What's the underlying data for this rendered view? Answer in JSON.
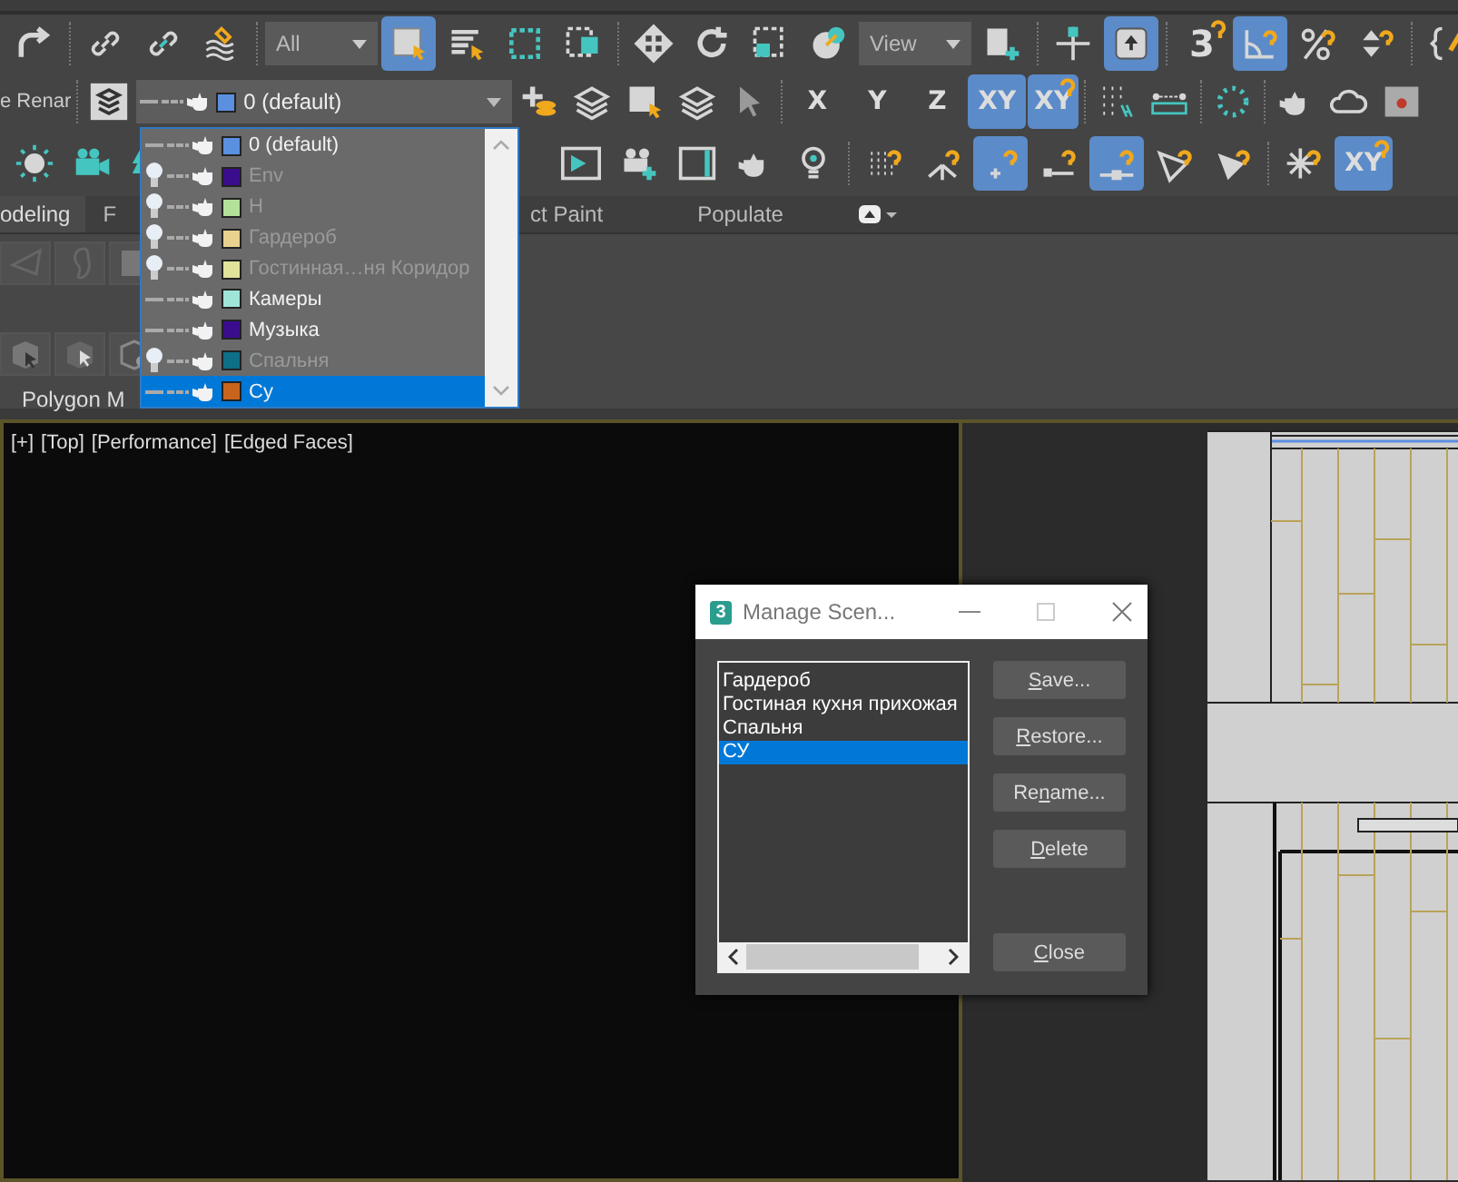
{
  "main_toolbar": {
    "rows": [
      {
        "groups": [
          {
            "items": [
              {
                "kind": "redo",
                "selected": false
              }
            ]
          },
          {
            "items": [
              {
                "kind": "link",
                "selected": false
              },
              {
                "kind": "unlink",
                "selected": false
              },
              {
                "kind": "bind",
                "selected": false
              }
            ]
          },
          {
            "items": [
              {
                "kind": "dropdown",
                "value": "All"
              },
              {
                "kind": "select",
                "selected": true
              },
              {
                "kind": "select_list",
                "selected": false
              },
              {
                "kind": "region",
                "selected": false
              },
              {
                "kind": "crossing",
                "selected": false
              }
            ]
          },
          {
            "items": [
              {
                "kind": "move",
                "selected": false
              },
              {
                "kind": "rotate",
                "selected": false
              },
              {
                "kind": "region_alt",
                "selected": false
              },
              {
                "kind": "place",
                "selected": false
              },
              {
                "kind": "dropdown",
                "value": "View"
              },
              {
                "kind": "pivot",
                "selected": false
              }
            ]
          },
          {
            "items": [
              {
                "kind": "manipulate",
                "selected": false
              },
              {
                "kind": "shortcut",
                "selected": true
              }
            ]
          },
          {
            "items": [
              {
                "kind": "snap",
                "label": "3",
                "selected": false
              },
              {
                "kind": "angle",
                "selected": true
              },
              {
                "kind": "percent",
                "selected": false
              },
              {
                "kind": "spinner",
                "selected": false
              }
            ]
          },
          {
            "items": [
              {
                "kind": "brace",
                "selected": false
              }
            ]
          }
        ]
      },
      {
        "groups": [
          {
            "items": [
              {
                "kind": "label",
                "label": "e Renar"
              }
            ]
          },
          {
            "items": [
              {
                "kind": "layers",
                "selected": false
              },
              {
                "kind": "layer_dropdown",
                "value": "0 (default)"
              },
              {
                "kind": "add_layer",
                "selected": false
              },
              {
                "kind": "layer_stack",
                "selected": false
              },
              {
                "kind": "select_layer",
                "selected": false
              },
              {
                "kind": "layer_stack",
                "selected": false
              },
              {
                "kind": "cursor",
                "selected": false
              }
            ]
          },
          {
            "items": [
              {
                "kind": "axis",
                "label": "X",
                "selected": false
              },
              {
                "kind": "axis",
                "label": "Y",
                "selected": false
              },
              {
                "kind": "axis",
                "label": "Z",
                "selected": false
              },
              {
                "kind": "axis",
                "label": "XY",
                "selected": true
              },
              {
                "kind": "axis_snap",
                "label": "XY",
                "selected": true
              }
            ]
          },
          {
            "items": [
              {
                "kind": "grid_dots",
                "selected": false
              },
              {
                "kind": "ruler",
                "selected": false
              }
            ]
          },
          {
            "items": [
              {
                "kind": "ring",
                "selected": false
              }
            ]
          },
          {
            "items": [
              {
                "kind": "teapot",
                "selected": false
              },
              {
                "kind": "cloud",
                "selected": false
              },
              {
                "kind": "render",
                "selected": false
              }
            ]
          }
        ]
      },
      {
        "groups": [
          {
            "items": [
              {
                "kind": "sun",
                "selected": false
              },
              {
                "kind": "camera",
                "selected": false
              },
              {
                "kind": "tree",
                "selected": false
              }
            ]
          },
          {
            "items": [
              {
                "kind": "frame",
                "selected": false
              },
              {
                "kind": "camera_add",
                "selected": false
              },
              {
                "kind": "window",
                "selected": false
              },
              {
                "kind": "teapot",
                "selected": false
              },
              {
                "kind": "bulb",
                "selected": false
              }
            ]
          },
          {
            "items": [
              {
                "kind": "snap_grid",
                "selected": false
              },
              {
                "kind": "snap_axis",
                "selected": false
              },
              {
                "kind": "snap_point",
                "selected": true
              },
              {
                "kind": "snap_line",
                "selected": false
              },
              {
                "kind": "snap_mid",
                "selected": true
              },
              {
                "kind": "snap_tri",
                "selected": false
              },
              {
                "kind": "snap_tri_fill",
                "selected": false
              }
            ]
          },
          {
            "items": [
              {
                "kind": "freeze",
                "selected": false
              },
              {
                "kind": "axis_snap",
                "label": "XY",
                "selected": true
              }
            ]
          }
        ]
      }
    ]
  },
  "layer_list": [
    {
      "name": "0 (default)",
      "color": "#5b8fe0",
      "hidden": false,
      "selected": false
    },
    {
      "name": "Env",
      "color": "#3a0d8c",
      "hidden": true,
      "selected": false
    },
    {
      "name": "H",
      "color": "#b3e09a",
      "hidden": true,
      "selected": false
    },
    {
      "name": "Гардероб",
      "color": "#e8d28e",
      "hidden": true,
      "selected": false
    },
    {
      "name": "Гостинная…ня Коридор",
      "color": "#e0e39a",
      "hidden": true,
      "selected": false
    },
    {
      "name": "Камеры",
      "color": "#a0e6d8",
      "hidden": false,
      "selected": false
    },
    {
      "name": "Музыка",
      "color": "#3a0d8c",
      "hidden": false,
      "selected": false
    },
    {
      "name": "Спальня",
      "color": "#0e6f86",
      "hidden": true,
      "selected": false
    },
    {
      "name": "Су",
      "color": "#c8641e",
      "hidden": false,
      "selected": true
    }
  ],
  "ribbon": {
    "tabs": [
      {
        "label": "odeling",
        "selected": true
      },
      {
        "label": "F",
        "selected": false
      },
      {
        "label": "ct Paint",
        "selected": false
      },
      {
        "label": "Populate",
        "selected": false
      }
    ],
    "panel_label": "Polygon M"
  },
  "viewport": {
    "labels": [
      "[+]",
      "[Top]",
      "[Performance]",
      "[Edged Faces]"
    ]
  },
  "dialog": {
    "app_badge": "3",
    "title": "Manage Scen...",
    "scenes": [
      {
        "name": "Гардероб",
        "selected": false
      },
      {
        "name": "Гостиная кухня прихожая",
        "selected": false
      },
      {
        "name": "Спальня",
        "selected": false
      },
      {
        "name": "СУ",
        "selected": true
      }
    ],
    "buttons": [
      {
        "key": "S",
        "after": "ave..."
      },
      {
        "key": "R",
        "after": "estore..."
      },
      {
        "before": "Re",
        "key": "n",
        "after": "ame..."
      },
      {
        "key": "D",
        "after": "elete"
      },
      {
        "key": "C",
        "after": "lose"
      }
    ]
  }
}
